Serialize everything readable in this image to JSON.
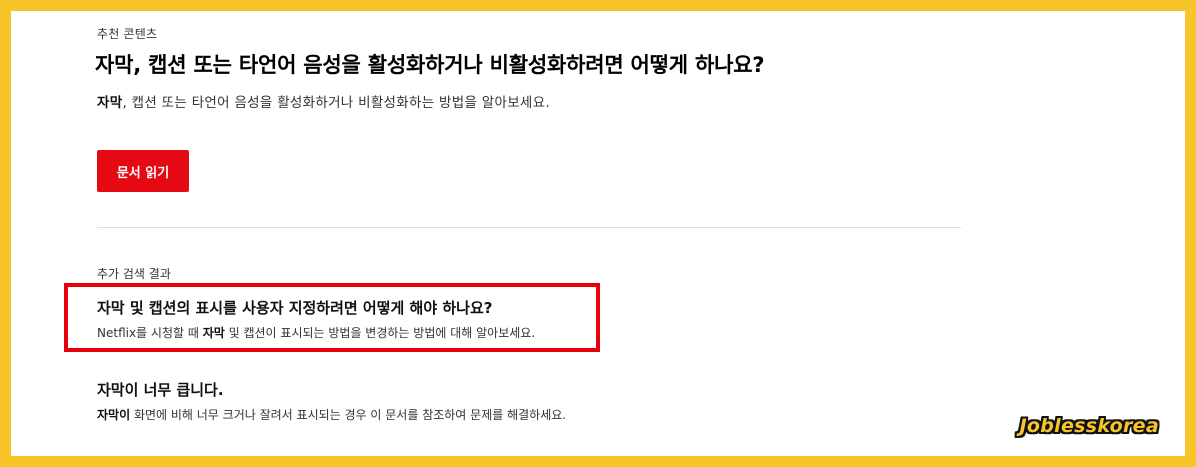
{
  "recommended": {
    "section_label": "추천 콘텐츠",
    "title": "자막, 캡션 또는 타언어 음성을 활성화하거나 비활성화하려면 어떻게 하나요?",
    "desc_bold": "자막",
    "desc_rest": ", 캡션 또는 타언어 음성을 활성화하거나 비활성화하는 방법을 알아보세요.",
    "read_button": "문서 읽기"
  },
  "more_results": {
    "section_label": "추가 검색 결과",
    "items": [
      {
        "title": "자막 및 캡션의 표시를 사용자 지정하려면 어떻게 해야 하나요?",
        "desc_pre": "Netflix를 시청할 때 ",
        "desc_bold": "자막",
        "desc_post": " 및 캡션이 표시되는 방법을 변경하는 방법에 대해 알아보세요."
      },
      {
        "title": "자막이 너무 큽니다.",
        "desc_pre": "",
        "desc_bold": "자막이",
        "desc_post": " 화면에 비해 너무 크거나 잘려서 표시되는 경우 이 문서를 참조하여 문제를 해결하세요."
      }
    ]
  },
  "watermark": "Joblesskorea",
  "colors": {
    "border_accent": "#f7c42a",
    "button_red": "#e50914",
    "highlight_red": "#e8000b"
  }
}
